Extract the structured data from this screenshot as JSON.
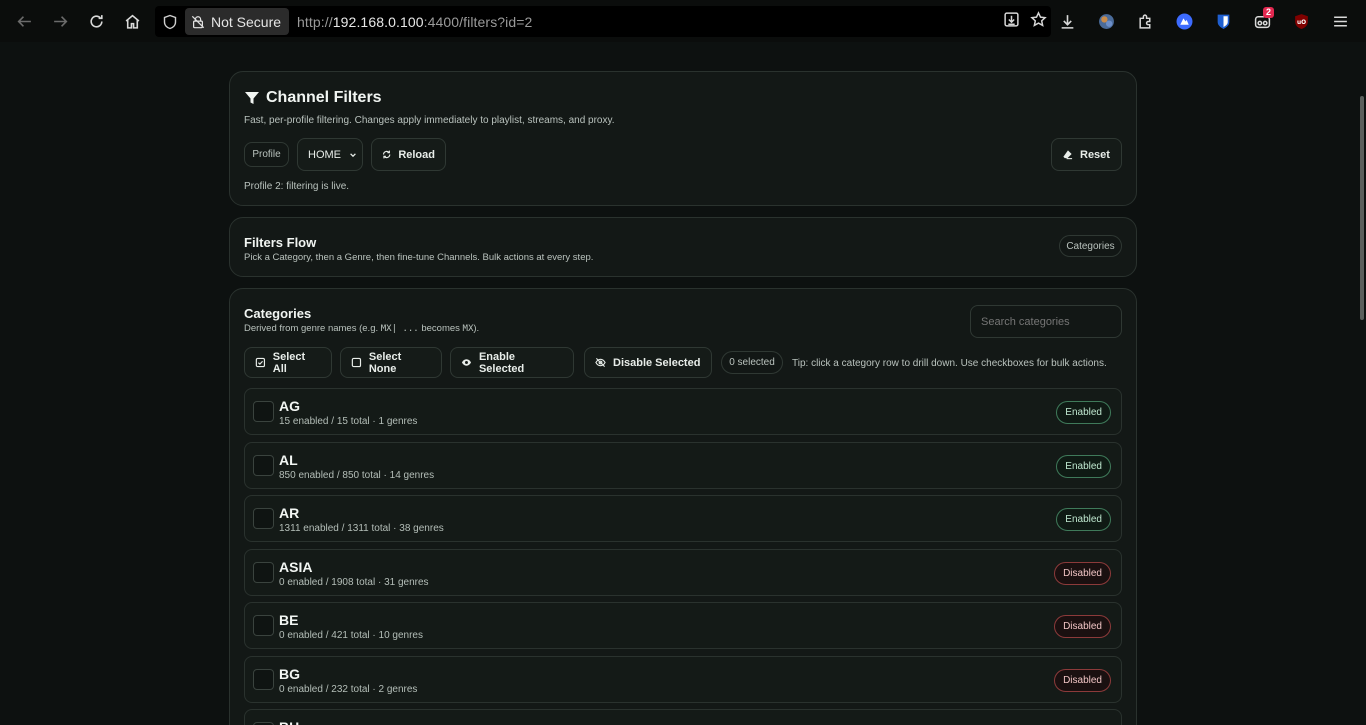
{
  "browser": {
    "security_label": "Not Secure",
    "url_prefix": "http://",
    "url_host": "192.168.0.100",
    "url_rest": ":4400/filters?id=2",
    "ext_badge": "2"
  },
  "header": {
    "title": "Channel Filters",
    "subtitle": "Fast, per-profile filtering. Changes apply immediately to playlist, streams, and proxy.",
    "profile_chip": "Profile",
    "profile_value": "HOME",
    "reload_label": "Reload",
    "reset_label": "Reset",
    "status_text": "Profile 2: filtering is live."
  },
  "flow": {
    "title": "Filters Flow",
    "subtitle": "Pick a Category, then a Genre, then fine-tune Channels. Bulk actions at every step.",
    "chip": "Categories"
  },
  "categories": {
    "title": "Categories",
    "subtitle_pre": "Derived from genre names (e.g. ",
    "subtitle_code1": "MX| ...",
    "subtitle_mid": " becomes ",
    "subtitle_code2": "MX",
    "subtitle_post": ").",
    "search_placeholder": "Search categories",
    "select_all": "Select All",
    "select_none": "Select None",
    "enable_selected": "Enable Selected",
    "disable_selected": "Disable Selected",
    "selected_count": "0 selected",
    "tip": "Tip: click a category row to drill down. Use checkboxes for bulk actions.",
    "rows": [
      {
        "code": "AG",
        "stats": "15 enabled / 15 total · 1 genres",
        "status": "Enabled"
      },
      {
        "code": "AL",
        "stats": "850 enabled / 850 total · 14 genres",
        "status": "Enabled"
      },
      {
        "code": "AR",
        "stats": "1311 enabled / 1311 total · 38 genres",
        "status": "Enabled"
      },
      {
        "code": "ASIA",
        "stats": "0 enabled / 1908 total · 31 genres",
        "status": "Disabled"
      },
      {
        "code": "BE",
        "stats": "0 enabled / 421 total · 10 genres",
        "status": "Disabled"
      },
      {
        "code": "BG",
        "stats": "0 enabled / 232 total · 2 genres",
        "status": "Disabled"
      },
      {
        "code": "BH",
        "stats": "",
        "status": ""
      }
    ]
  },
  "colors": {
    "background": "#0d1110",
    "enabled": "#3f7a5a",
    "disabled": "#8c3a3a"
  }
}
